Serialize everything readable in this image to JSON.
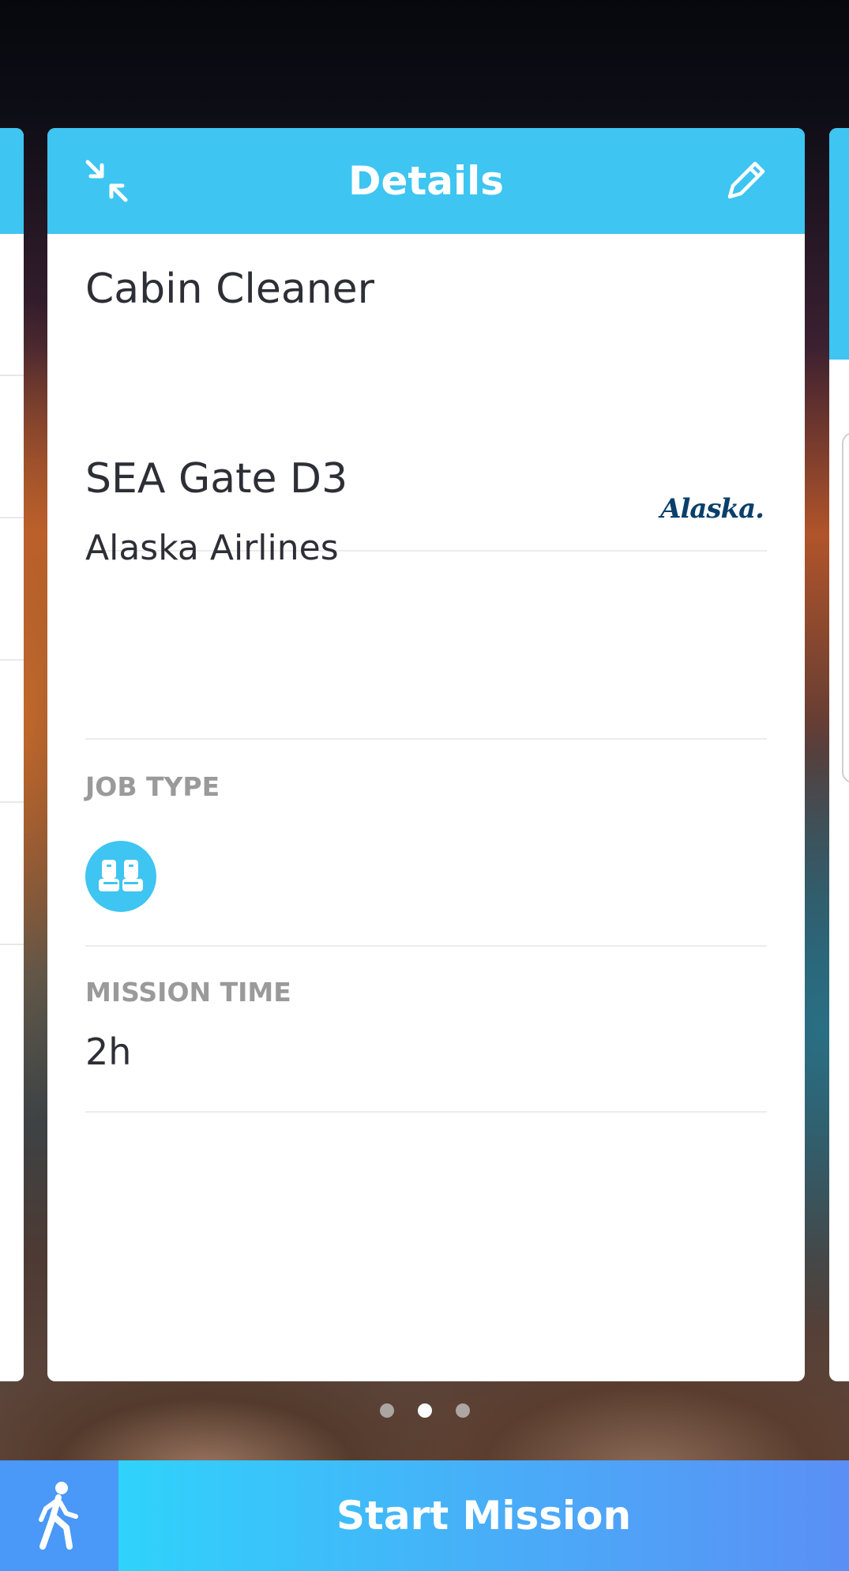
{
  "header": {
    "title": "Details",
    "collapse_icon": "collapse-icon",
    "edit_icon": "pencil-icon",
    "color": "#3ec5f2"
  },
  "task": {
    "title": "Cabin Cleaner"
  },
  "location": {
    "name": "SEA Gate D3",
    "airline": "Alaska Airlines",
    "logo_text": "Alaska."
  },
  "job_type": {
    "label": "JOB TYPE",
    "icon": "airplane-seats-icon"
  },
  "mission_time": {
    "label": "MISSION TIME",
    "value": "2h"
  },
  "pagination": {
    "count": 3,
    "active_index": 1
  },
  "bottom_bar": {
    "walk_icon": "walking-person-icon",
    "start_label": "Start Mission"
  }
}
